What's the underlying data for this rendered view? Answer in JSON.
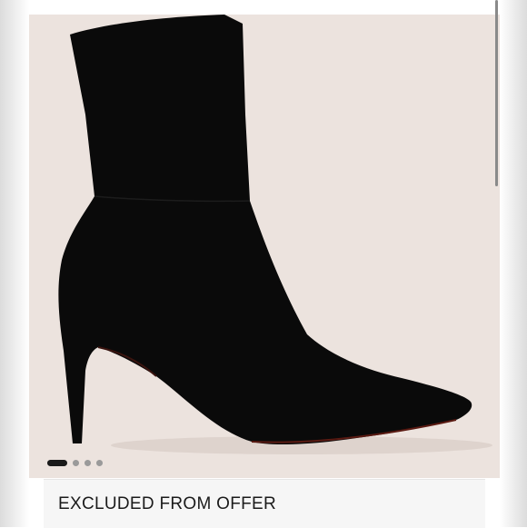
{
  "product_gallery": {
    "image_alt": "Black pointed-toe stiletto sock ankle boot",
    "slide_count": 4,
    "active_slide": 1
  },
  "offer_banner": {
    "text": "EXCLUDED FROM OFFER"
  },
  "colors": {
    "image_background": "#ece3de",
    "boot": "#0a0a0a",
    "dot_active": "#1a1a1a",
    "dot_inactive": "#9a9a9a"
  }
}
